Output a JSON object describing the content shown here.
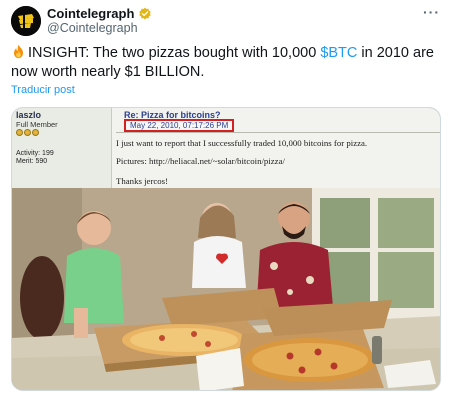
{
  "account": {
    "display_name": "Cointelegraph",
    "handle": "@Cointelegraph",
    "more_label": "···"
  },
  "tweet": {
    "text_before": "INSIGHT: The two pizzas bought with 10,000 ",
    "cashtag": "$BTC",
    "text_after": " in 2010 are now worth nearly $1 BILLION.",
    "translate_label": "Traducir post"
  },
  "forum": {
    "username": "laszlo",
    "rank": "Full Member",
    "activity": "Activity: 199",
    "merit": "Merit: 590",
    "title": "Re: Pizza for bitcoins?",
    "date": "May 22, 2010, 07:17:26 PM",
    "line1": "I just want to report that I successfully traded 10,000 bitcoins for pizza.",
    "line2_label": "Pictures:",
    "line2_url": "http://heliacal.net/~solar/bitcoin/pizza/",
    "line3": "Thanks jercos!"
  },
  "colors": {
    "accent": "#1d9bf0",
    "verified_gold": "#e2b719",
    "highlight_box": "#d32020"
  },
  "icons": {
    "avatar": "cointelegraph-logo-icon",
    "verified": "verified-badge-icon",
    "fire": "fire-emoji-icon",
    "more": "more-options-icon"
  }
}
